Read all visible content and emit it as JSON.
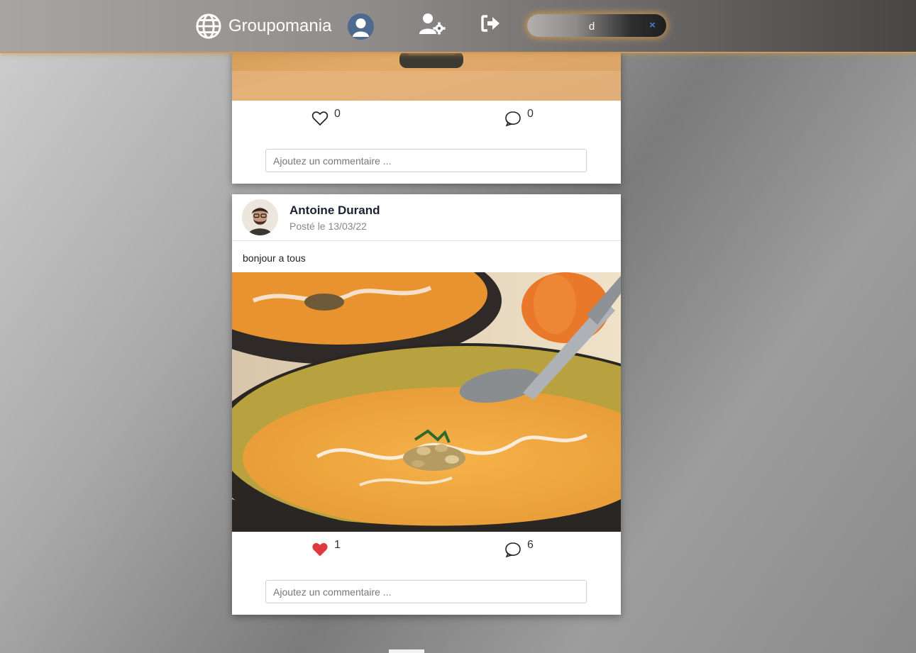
{
  "header": {
    "app_name": "Groupomania",
    "logo_icon": "globe-icon",
    "profile_icon": "user-avatar-icon",
    "settings_icon": "user-settings-icon",
    "logout_icon": "sign-out-icon",
    "search": {
      "value": "d",
      "clear_label": "×"
    },
    "accent_color": "#c99a5a"
  },
  "feed": {
    "posts": [
      {
        "image": "food-photo-partial",
        "likes": "0",
        "liked": false,
        "comments": "0",
        "comment_placeholder": "Ajoutez un commentaire ..."
      },
      {
        "author": "Antoine Durand",
        "date": "Posté le 13/03/22",
        "text": "bonjour a tous",
        "image": "pumpkin-soup-photo",
        "likes": "1",
        "liked": true,
        "comments": "6",
        "comment_placeholder": "Ajoutez un commentaire ...",
        "like_color": "#e0393e"
      }
    ]
  }
}
